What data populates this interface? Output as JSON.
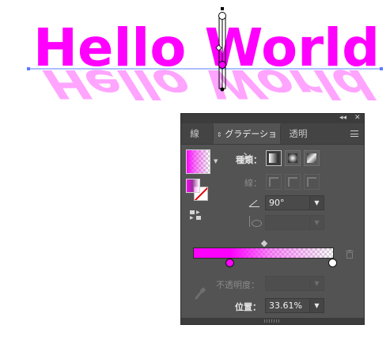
{
  "artwork": {
    "text": "Hello World",
    "fill_color": "#ff00ff",
    "path_color": "#5b7cff"
  },
  "panel": {
    "collapse_icon": "double-chevron-left-icon",
    "close_icon": "close-icon",
    "tabs": [
      {
        "label": "線",
        "active": false
      },
      {
        "label": "グラデーション",
        "active": true
      },
      {
        "label": "透明",
        "active": false
      }
    ],
    "menu_icon": "hamburger-menu-icon",
    "type_label": "種類：",
    "stroke_label": "線：",
    "angle_value": "90°",
    "opacity_label": "不透明度：",
    "position_label": "位置：",
    "position_value": "33.61%",
    "gradient_start_color": "#ff00ff",
    "stop_location_percent": 33.61
  }
}
